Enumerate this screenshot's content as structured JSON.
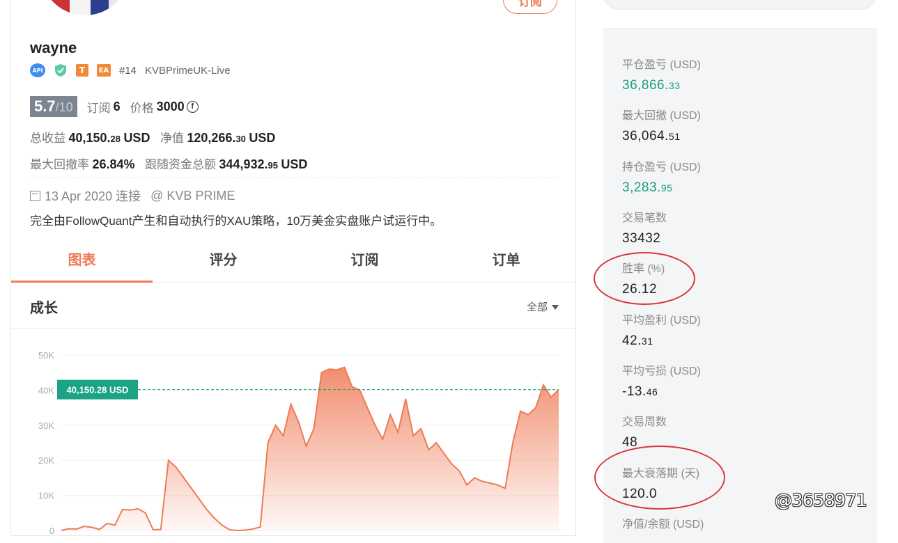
{
  "profile": {
    "subscribe_label": "订阅",
    "username": "wayne",
    "badges": {
      "api": "API",
      "t": "T",
      "ea": "EA"
    },
    "rank": "#14",
    "broker": "KVBPrimeUK-Live",
    "score": "5.7",
    "score_max": "/10",
    "subs_label": "订阅",
    "subs_value": "6",
    "price_label": "价格",
    "price_value": "3000",
    "price_icon": "coin-icon",
    "total_profit_label": "总收益",
    "total_profit_int": "40,150.",
    "total_profit_dec": "28",
    "total_profit_unit": "USD",
    "equity_label": "净值",
    "equity_int": "120,266.",
    "equity_dec": "30",
    "equity_unit": "USD",
    "max_dd_label": "最大回撤率",
    "max_dd_value": "26.84%",
    "follow_label": "跟随资金总额",
    "follow_int": "344,932.",
    "follow_dec": "95",
    "follow_unit": "USD",
    "date_text": "13 Apr 2020 连接",
    "provider": "@ KVB PRIME",
    "description": "完全由FollowQuant产生和自动执行的XAU策略，10万美金实盘账户试运行中。"
  },
  "tabs": [
    {
      "label": "图表",
      "active": true
    },
    {
      "label": "评分",
      "active": false
    },
    {
      "label": "订阅",
      "active": false
    },
    {
      "label": "订单",
      "active": false
    }
  ],
  "growth": {
    "title": "成长",
    "filter": "全部"
  },
  "chart_data": {
    "type": "area",
    "y_ticks": [
      "50K",
      "40K",
      "30K",
      "20K",
      "10K",
      "0"
    ],
    "ylim": [
      0,
      50000
    ],
    "current_label": "40,150.28 USD",
    "current_value": 40150.28,
    "line_color": "#ef7a55",
    "reference_color": "#1aa385",
    "values": [
      0,
      500,
      400,
      1200,
      900,
      300,
      2000,
      1500,
      6000,
      5800,
      6200,
      5000,
      200,
      300,
      20000,
      18000,
      15000,
      12000,
      9000,
      6000,
      3500,
      1500,
      200,
      0,
      100,
      400,
      1000,
      25000,
      30000,
      27000,
      36000,
      31000,
      24000,
      29000,
      45000,
      46000,
      45800,
      46500,
      41000,
      40000,
      35000,
      30000,
      26000,
      33000,
      28000,
      37500,
      27000,
      29000,
      23000,
      25000,
      22000,
      19000,
      17000,
      13000,
      15000,
      14000,
      13500,
      13000,
      12000,
      25000,
      34000,
      33000,
      35000,
      41500,
      38000,
      40150
    ]
  },
  "stats": [
    {
      "label": "平仓盈亏 (USD)",
      "int": "36,866.",
      "dec": "33",
      "color": "green"
    },
    {
      "label": "最大回撤 (USD)",
      "int": "36,064.",
      "dec": "51",
      "color": "dark"
    },
    {
      "label": "持仓盈亏 (USD)",
      "int": "3,283.",
      "dec": "95",
      "color": "green"
    },
    {
      "label": "交易笔数",
      "int": "33432",
      "dec": "",
      "color": "dark"
    },
    {
      "label": "胜率 (%)",
      "int": "26.12",
      "dec": "",
      "color": "dark"
    },
    {
      "label": "平均盈利 (USD)",
      "int": "42.",
      "dec": "31",
      "color": "dark"
    },
    {
      "label": "平均亏损 (USD)",
      "int": "-13.",
      "dec": "46",
      "color": "dark"
    },
    {
      "label": "交易周数",
      "int": "48",
      "dec": "",
      "color": "dark"
    },
    {
      "label": "最大衰落期 (天)",
      "int": "120.0",
      "dec": "",
      "color": "dark"
    },
    {
      "label": "净值/余额 (USD)",
      "int": "",
      "dec": "",
      "color": "dark"
    }
  ],
  "watermark": "@3658971",
  "colors": {
    "accent": "#ef7a55",
    "green": "#1a9e7f",
    "annotation": "#d9363e"
  }
}
